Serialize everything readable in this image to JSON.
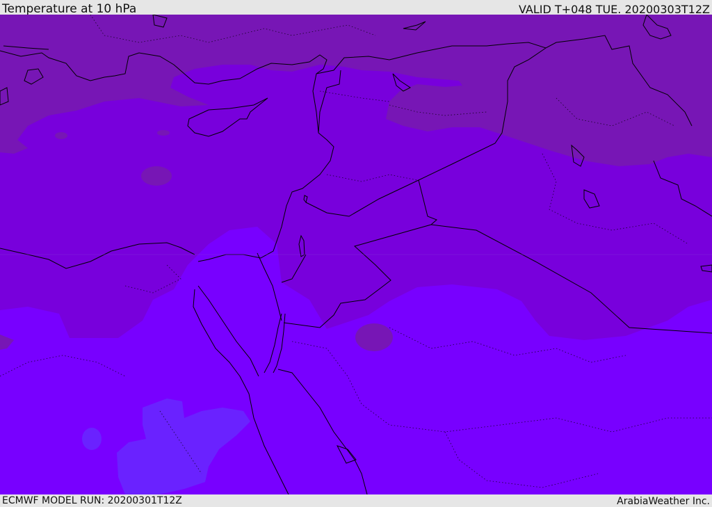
{
  "header": {
    "title": "Temperature at 10 hPa",
    "valid": "VALID T+048 TUE. 20200303T12Z"
  },
  "footer": {
    "model_run": "ECMWF MODEL RUN: 20200301T12Z",
    "credit": "ArabiaWeather Inc."
  },
  "map": {
    "region": "Eastern Mediterranean / Levant",
    "colors": {
      "coldest": "#7716b5",
      "cold": "#7800dc",
      "cool": "#7800ff",
      "mild": "#6a22ff",
      "outline": "#000000"
    }
  }
}
